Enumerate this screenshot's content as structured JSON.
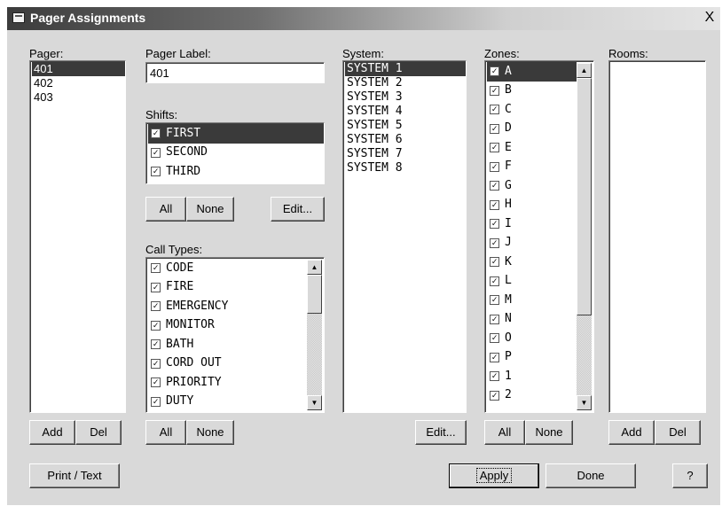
{
  "window": {
    "title": "Pager Assignments",
    "close_glyph": "X"
  },
  "pager": {
    "label": "Pager:",
    "items": [
      "401",
      "402",
      "403"
    ],
    "selected": "401",
    "add_label": "Add",
    "del_label": "Del",
    "print_label": "Print / Text"
  },
  "pager_label": {
    "label": "Pager Label:",
    "value": "401"
  },
  "shifts": {
    "label": "Shifts:",
    "items": [
      {
        "text": "FIRST",
        "checked": true
      },
      {
        "text": "SECOND",
        "checked": true
      },
      {
        "text": "THIRD",
        "checked": true
      }
    ],
    "all_label": "All",
    "none_label": "None",
    "edit_label": "Edit..."
  },
  "call_types": {
    "label": "Call Types:",
    "items": [
      {
        "text": "CODE",
        "checked": true
      },
      {
        "text": "FIRE",
        "checked": true
      },
      {
        "text": "EMERGENCY",
        "checked": true
      },
      {
        "text": "MONITOR",
        "checked": true
      },
      {
        "text": "BATH",
        "checked": true
      },
      {
        "text": "CORD OUT",
        "checked": true
      },
      {
        "text": "PRIORITY",
        "checked": true
      },
      {
        "text": "DUTY",
        "checked": true
      }
    ],
    "all_label": "All",
    "none_label": "None"
  },
  "system": {
    "label": "System:",
    "items": [
      "SYSTEM 1",
      "SYSTEM 2",
      "SYSTEM 3",
      "SYSTEM 4",
      "SYSTEM 5",
      "SYSTEM 6",
      "SYSTEM 7",
      "SYSTEM 8"
    ],
    "edit_label": "Edit..."
  },
  "zones": {
    "label": "Zones:",
    "items": [
      {
        "text": "A",
        "checked": true
      },
      {
        "text": "B",
        "checked": true
      },
      {
        "text": "C",
        "checked": true
      },
      {
        "text": "D",
        "checked": true
      },
      {
        "text": "E",
        "checked": true
      },
      {
        "text": "F",
        "checked": true
      },
      {
        "text": "G",
        "checked": true
      },
      {
        "text": "H",
        "checked": true
      },
      {
        "text": "I",
        "checked": true
      },
      {
        "text": "J",
        "checked": true
      },
      {
        "text": "K",
        "checked": true
      },
      {
        "text": "L",
        "checked": true
      },
      {
        "text": "M",
        "checked": true
      },
      {
        "text": "N",
        "checked": true
      },
      {
        "text": "O",
        "checked": true
      },
      {
        "text": "P",
        "checked": true
      },
      {
        "text": "1",
        "checked": true
      },
      {
        "text": "2",
        "checked": true
      }
    ],
    "all_label": "All",
    "none_label": "None"
  },
  "rooms": {
    "label": "Rooms:",
    "items": [],
    "add_label": "Add",
    "del_label": "Del"
  },
  "footer": {
    "apply_label": "Apply",
    "done_label": "Done",
    "help_label": "?"
  },
  "icons": {
    "checkmark": "✓",
    "scroll_up": "▲",
    "scroll_down": "▼"
  }
}
